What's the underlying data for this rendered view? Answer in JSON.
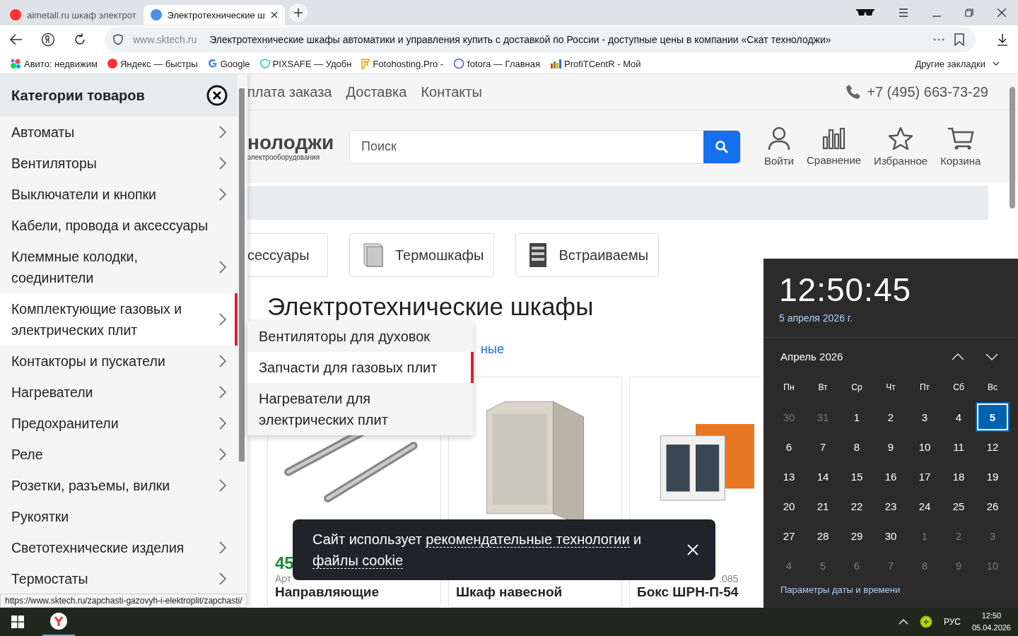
{
  "browser": {
    "tabs": [
      {
        "title": "aimetall.ru шкаф электрот",
        "selected": false
      },
      {
        "title": "Электротехнические ш",
        "selected": true
      }
    ],
    "address": {
      "domain": "www.sktech.ru",
      "title": "Электротехнические шкафы автоматики и управления купить с доставкой по России - доступные цены в компании «Скат технолоджи»"
    },
    "bookmarks": [
      {
        "label": "Авито: недвижим"
      },
      {
        "label": "Яндекс — быстры"
      },
      {
        "label": "Google"
      },
      {
        "label": "PIXSAFE — Удобн"
      },
      {
        "label": "Fotohosting.Pro -"
      },
      {
        "label": "fotora — Главная"
      },
      {
        "label": "ProfiTCentR - Мой"
      }
    ],
    "other_bookmarks": "Другие закладки"
  },
  "site": {
    "nav_links": [
      "плата заказа",
      "Доставка",
      "Контакты"
    ],
    "phone": "+7 (495) 663-73-29",
    "logo": {
      "name": "нолоджи",
      "tagline": "электрооборудования"
    },
    "search": {
      "placeholder": "Поиск"
    },
    "header_actions": [
      {
        "label": "Войти"
      },
      {
        "label": "Сравнение"
      },
      {
        "label": "Избранное"
      },
      {
        "label": "Корзина"
      }
    ],
    "categories": [
      {
        "label": "сессуары"
      },
      {
        "label": "Термошкафы"
      },
      {
        "label": "Встраиваемы"
      }
    ],
    "heading": "Электротехнические шкафы",
    "filter_link": "ные",
    "products": [
      {
        "price": "45",
        "article": "Арт",
        "title": "Направляющие"
      },
      {
        "title": "Шкаф навесной"
      },
      {
        "article": ".085",
        "title": "Бокс ШРН-П-54"
      }
    ]
  },
  "sidebar": {
    "title": "Категории товаров",
    "items": [
      {
        "label": "Автоматы",
        "has_submenu": true,
        "selected": false
      },
      {
        "label": "Вентиляторы",
        "has_submenu": true,
        "selected": false
      },
      {
        "label": "Выключатели и кнопки",
        "has_submenu": true,
        "selected": false
      },
      {
        "label": "Кабели, провода и аксессуары",
        "has_submenu": false,
        "selected": false
      },
      {
        "label": "Клеммные колодки, соединители",
        "has_submenu": true,
        "selected": false
      },
      {
        "label": "Комплектующие газовых и электрических плит",
        "has_submenu": true,
        "selected": true
      },
      {
        "label": "Контакторы и пускатели",
        "has_submenu": true,
        "selected": false
      },
      {
        "label": "Нагреватели",
        "has_submenu": true,
        "selected": false
      },
      {
        "label": "Предохранители",
        "has_submenu": true,
        "selected": false
      },
      {
        "label": "Реле",
        "has_submenu": true,
        "selected": false
      },
      {
        "label": "Розетки, разъемы, вилки",
        "has_submenu": true,
        "selected": false
      },
      {
        "label": "Рукоятки",
        "has_submenu": false,
        "selected": false
      },
      {
        "label": "Светотехнические изделия",
        "has_submenu": true,
        "selected": false
      },
      {
        "label": "Термостаты",
        "has_submenu": true,
        "selected": false
      }
    ]
  },
  "submenu": [
    {
      "label": "Вентиляторы для духовок",
      "selected": false
    },
    {
      "label": "Запчасти для газовых плит",
      "selected": true
    },
    {
      "label": "Нагреватели для электрических плит",
      "selected": false
    }
  ],
  "cookie_banner": {
    "parts": [
      {
        "text": "Сайт использует ",
        "link": false
      },
      {
        "text": "рекомендательные технологии",
        "link": true
      },
      {
        "text": " и ",
        "link": false
      },
      {
        "text": "файлы cookie",
        "link": true
      }
    ]
  },
  "status_url": "https://www.sktech.ru/zapchasti-gazovyh-i-elektroplit/zapchasti/",
  "calendar": {
    "time": "12:50:45",
    "date": "5 апреля 2026 г.",
    "month": "Апрель 2026",
    "weekdays": [
      "Пн",
      "Вт",
      "Ср",
      "Чт",
      "Пт",
      "Сб",
      "Вс"
    ],
    "weeks": [
      [
        {
          "day": "30",
          "in_month": false,
          "selected": false
        },
        {
          "day": "31",
          "in_month": false,
          "selected": false
        },
        {
          "day": "1",
          "in_month": true,
          "selected": false
        },
        {
          "day": "2",
          "in_month": true,
          "selected": false
        },
        {
          "day": "3",
          "in_month": true,
          "selected": false
        },
        {
          "day": "4",
          "in_month": true,
          "selected": false
        },
        {
          "day": "5",
          "in_month": true,
          "selected": true
        }
      ],
      [
        {
          "day": "6",
          "in_month": true,
          "selected": false
        },
        {
          "day": "7",
          "in_month": true,
          "selected": false
        },
        {
          "day": "8",
          "in_month": true,
          "selected": false
        },
        {
          "day": "9",
          "in_month": true,
          "selected": false
        },
        {
          "day": "10",
          "in_month": true,
          "selected": false
        },
        {
          "day": "11",
          "in_month": true,
          "selected": false
        },
        {
          "day": "12",
          "in_month": true,
          "selected": false
        }
      ],
      [
        {
          "day": "13",
          "in_month": true,
          "selected": false
        },
        {
          "day": "14",
          "in_month": true,
          "selected": false
        },
        {
          "day": "15",
          "in_month": true,
          "selected": false
        },
        {
          "day": "16",
          "in_month": true,
          "selected": false
        },
        {
          "day": "17",
          "in_month": true,
          "selected": false
        },
        {
          "day": "18",
          "in_month": true,
          "selected": false
        },
        {
          "day": "19",
          "in_month": true,
          "selected": false
        }
      ],
      [
        {
          "day": "20",
          "in_month": true,
          "selected": false
        },
        {
          "day": "21",
          "in_month": true,
          "selected": false
        },
        {
          "day": "22",
          "in_month": true,
          "selected": false
        },
        {
          "day": "23",
          "in_month": true,
          "selected": false
        },
        {
          "day": "24",
          "in_month": true,
          "selected": false
        },
        {
          "day": "25",
          "in_month": true,
          "selected": false
        },
        {
          "day": "26",
          "in_month": true,
          "selected": false
        }
      ],
      [
        {
          "day": "27",
          "in_month": true,
          "selected": false
        },
        {
          "day": "28",
          "in_month": true,
          "selected": false
        },
        {
          "day": "29",
          "in_month": true,
          "selected": false
        },
        {
          "day": "30",
          "in_month": true,
          "selected": false
        },
        {
          "day": "1",
          "in_month": false,
          "selected": false
        },
        {
          "day": "2",
          "in_month": false,
          "selected": false
        },
        {
          "day": "3",
          "in_month": false,
          "selected": false
        }
      ],
      [
        {
          "day": "4",
          "in_month": false,
          "selected": false
        },
        {
          "day": "5",
          "in_month": false,
          "selected": false
        },
        {
          "day": "6",
          "in_month": false,
          "selected": false
        },
        {
          "day": "7",
          "in_month": false,
          "selected": false
        },
        {
          "day": "8",
          "in_month": false,
          "selected": false
        },
        {
          "day": "9",
          "in_month": false,
          "selected": false
        },
        {
          "day": "10",
          "in_month": false,
          "selected": false
        }
      ]
    ],
    "settings_link": "Параметры даты и времени"
  },
  "taskbar": {
    "language": "РУС",
    "time": "12:50",
    "date": "05.04.2026"
  }
}
